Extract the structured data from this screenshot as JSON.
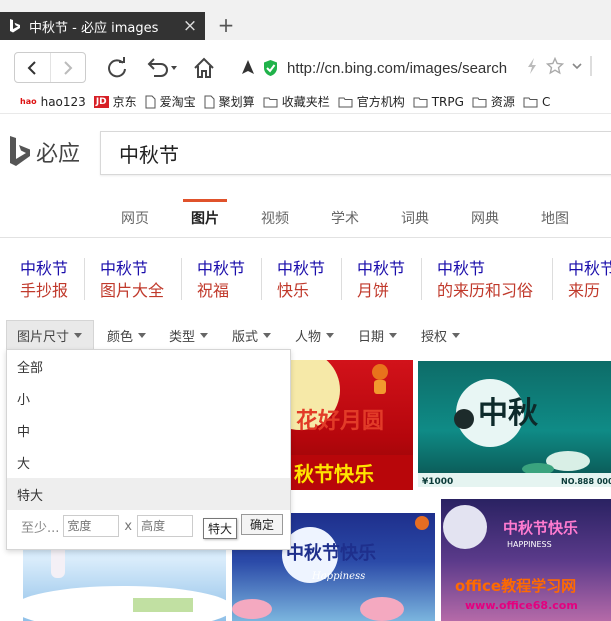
{
  "browser": {
    "tab_title": "中秋节 - 必应 images",
    "new_tab": "+",
    "address": "http://cn.bing.com/images/search",
    "bookmarks": [
      {
        "label": "hao123",
        "icon": "hao123-icon"
      },
      {
        "label": "京东",
        "icon": "jd-icon"
      },
      {
        "label": "爱淘宝",
        "icon": "page-icon"
      },
      {
        "label": "聚划算",
        "icon": "page-icon"
      },
      {
        "label": "收藏夹栏",
        "icon": "folder-icon"
      },
      {
        "label": "官方机构",
        "icon": "folder-icon"
      },
      {
        "label": "TRPG",
        "icon": "folder-icon"
      },
      {
        "label": "资源",
        "icon": "folder-icon"
      },
      {
        "label": "C",
        "icon": "folder-icon"
      }
    ],
    "jd_badge": "JD",
    "hao_badge": "hao"
  },
  "logo": {
    "text": "必应"
  },
  "search": {
    "query": "中秋节"
  },
  "scopes": [
    {
      "label": "网页",
      "active": false
    },
    {
      "label": "图片",
      "active": true
    },
    {
      "label": "视频",
      "active": false
    },
    {
      "label": "学术",
      "active": false
    },
    {
      "label": "词典",
      "active": false
    },
    {
      "label": "网典",
      "active": false
    },
    {
      "label": "地图",
      "active": false
    }
  ],
  "related": [
    {
      "line1": "中秋节",
      "line2": "手抄报"
    },
    {
      "line1": "中秋节",
      "line2": "图片大全"
    },
    {
      "line1": "中秋节",
      "line2": "祝福"
    },
    {
      "line1": "中秋节",
      "line2": "快乐"
    },
    {
      "line1": "中秋节",
      "line2": "月饼"
    },
    {
      "line1": "中秋节",
      "line2": "的来历和习俗"
    },
    {
      "line1": "中秋节",
      "line2": "来历"
    }
  ],
  "filters": [
    "图片尺寸",
    "颜色",
    "类型",
    "版式",
    "人物",
    "日期",
    "授权"
  ],
  "size_dropdown": {
    "options": [
      "全部",
      "小",
      "中",
      "大",
      "特大"
    ],
    "highlighted": "特大",
    "at_least": "至少...",
    "width_placeholder": "宽度",
    "times": "x",
    "height_placeholder": "高度",
    "confirm": "确定",
    "tooltip": "特大"
  },
  "image_text": {
    "img1_a": "花好月圆",
    "img1_b": "秋节快乐",
    "img2_a": "中秋",
    "img2_b": "¥1000",
    "img2_c": "NO.888 000",
    "img4_a": "中秋节快乐",
    "img4_b": "Happiness",
    "img5_a": "中秋节快乐",
    "img5_b": "HAPPINESS",
    "img5_c": "office教程学习网",
    "img5_d": "www.office68.com"
  }
}
